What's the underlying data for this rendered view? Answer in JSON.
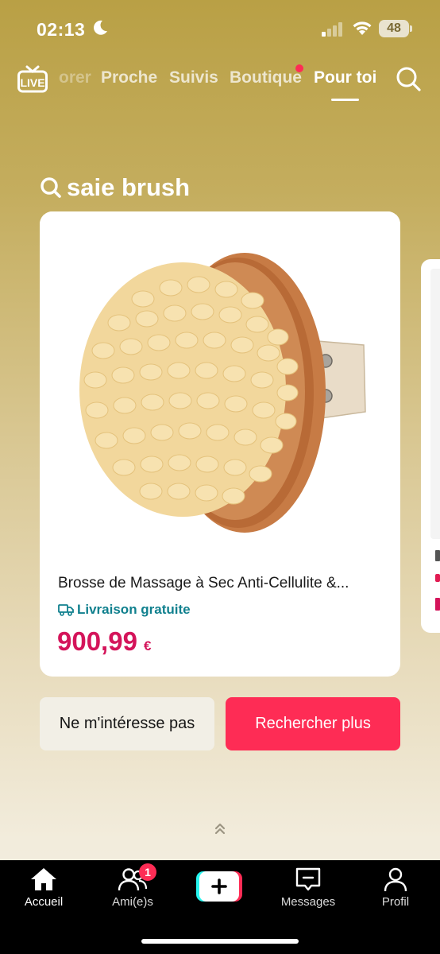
{
  "status_bar": {
    "time": "02:13",
    "battery": "48"
  },
  "top_nav": {
    "tabs": [
      {
        "label": "orer",
        "active": false
      },
      {
        "label": "Proche",
        "active": false
      },
      {
        "label": "Suivis",
        "active": false
      },
      {
        "label": "Boutique",
        "active": false
      },
      {
        "label": "Pour toi",
        "active": true
      }
    ],
    "live_label": "LIVE"
  },
  "search_heading": {
    "query": "saie brush"
  },
  "product": {
    "title": "Brosse de Massage à Sec Anti-Cellulite &...",
    "shipping": "Livraison gratuite",
    "price": "900,99",
    "currency": "€"
  },
  "actions": {
    "not_interested": "Ne m'intéresse pas",
    "search_more": "Rechercher plus"
  },
  "bottom_nav": {
    "home": "Accueil",
    "friends": "Ami(e)s",
    "friends_badge": "1",
    "messages": "Messages",
    "profile": "Profil"
  },
  "colors": {
    "accent": "#fe2c55",
    "price": "#d4145a",
    "shipping": "#10808e"
  }
}
